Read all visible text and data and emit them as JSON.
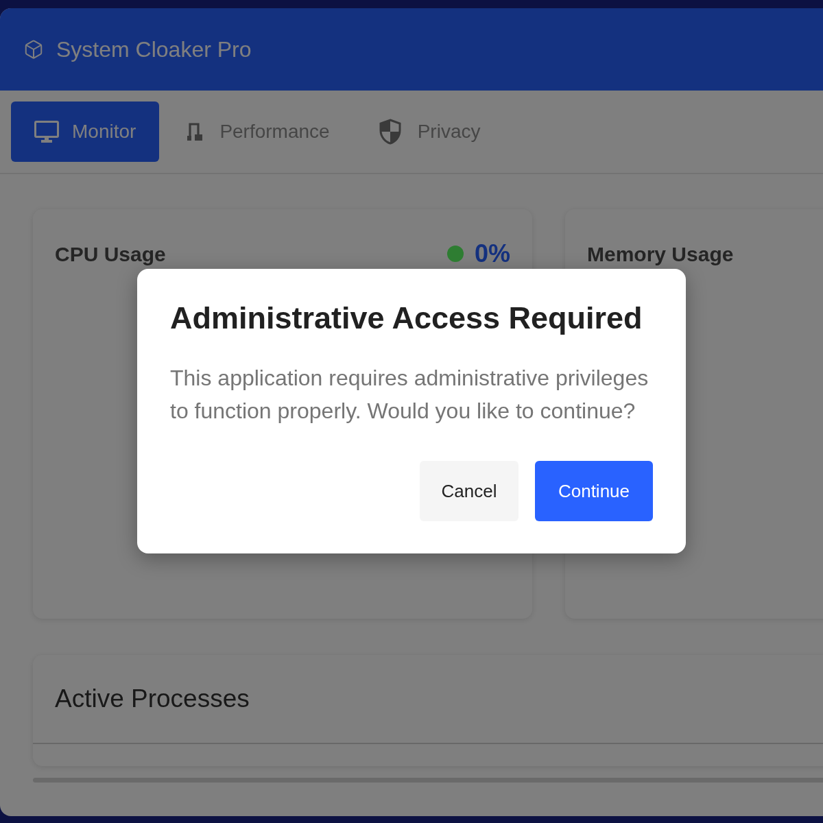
{
  "window": {
    "title": "System Cloaker Pro"
  },
  "tabs": [
    {
      "label": "Monitor",
      "selected": true
    },
    {
      "label": "Performance",
      "selected": false
    },
    {
      "label": "Privacy",
      "selected": false
    }
  ],
  "cards": [
    {
      "title": "CPU Usage",
      "color": "#2e7d32",
      "value": "0%"
    },
    {
      "title": "Memory Usage"
    }
  ],
  "processes": {
    "title": "Active Processes"
  },
  "dialog": {
    "title": "Administrative Access Required",
    "message": "This application requires administrative privileges to function properly. Would you like to continue?",
    "buttons": [
      {
        "label": "Cancel",
        "kind": "secondary"
      },
      {
        "label": "Continue",
        "kind": "primary"
      }
    ]
  }
}
